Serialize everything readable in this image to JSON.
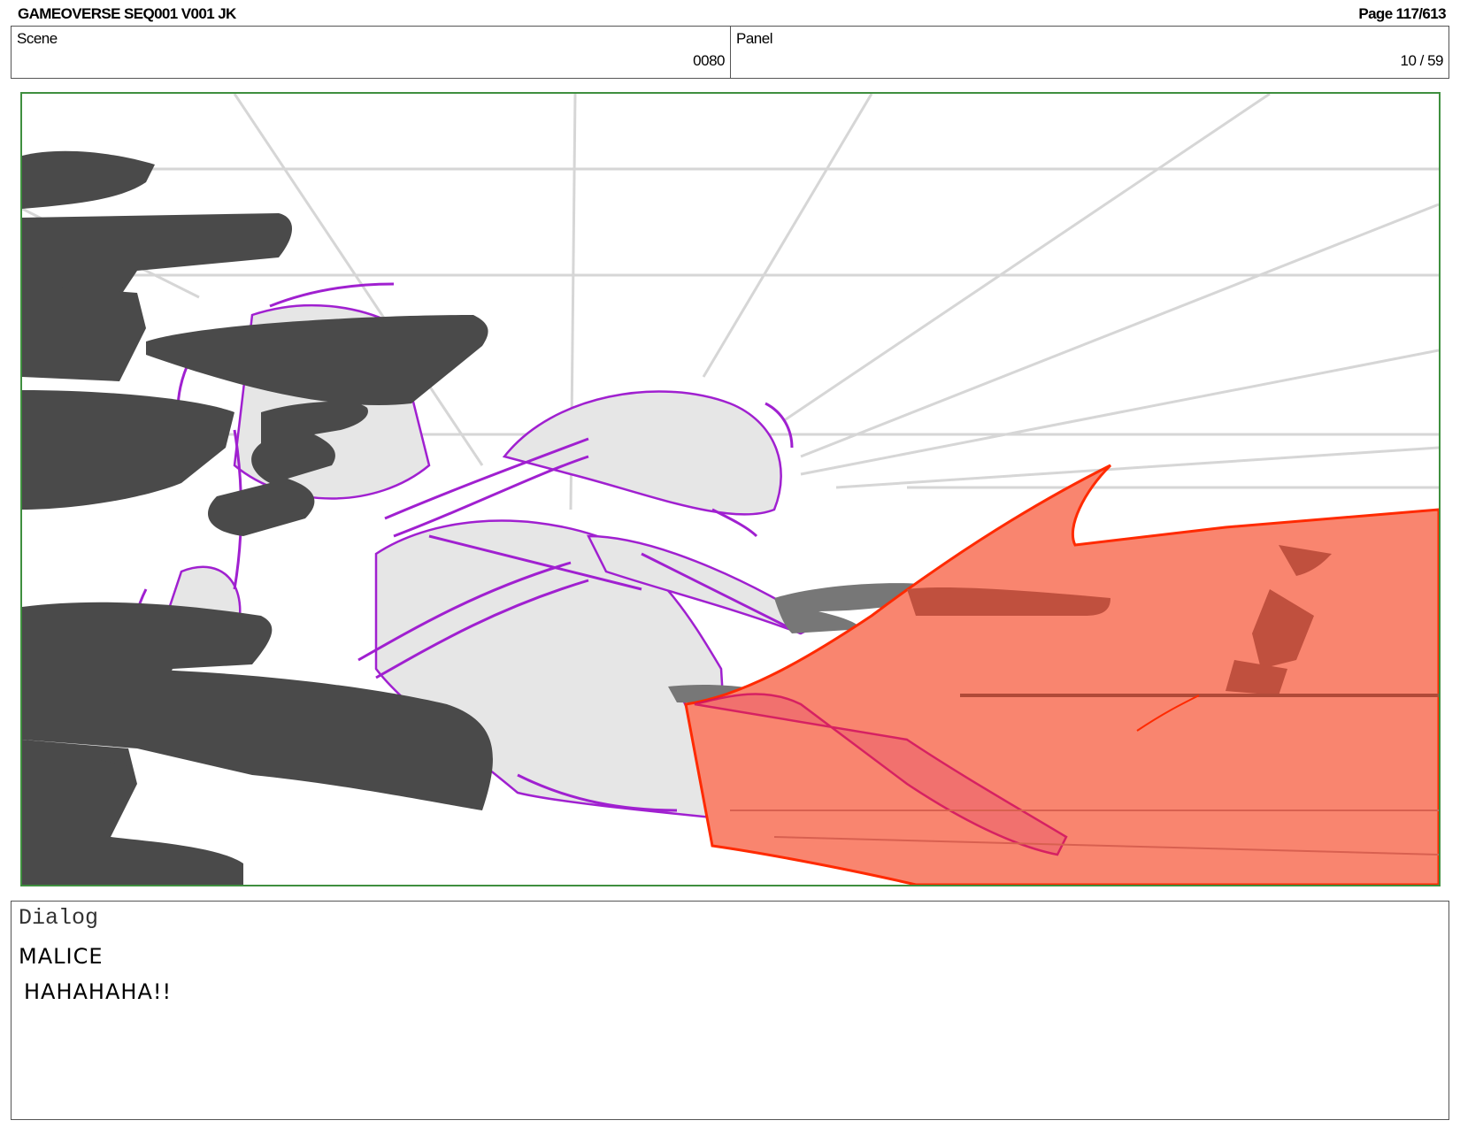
{
  "header": {
    "title": "GAMEOVERSE SEQ001 V001 JK",
    "page": "Page 117/613"
  },
  "info": {
    "scene_label": "Scene",
    "scene_value": "0080",
    "panel_label": "Panel",
    "panel_value": "10 / 59"
  },
  "panel_image": {
    "frame_color": "#3f8f3f",
    "colors": {
      "dark_shapes": "#4a4a4a",
      "sketch_purple": "#a020d0",
      "fill_gray": "#e6e6e6",
      "red_shape": "#f9856f",
      "red_stroke": "#ff2a00",
      "speed_lines": "#d6d6d6"
    }
  },
  "dialog": {
    "label": "Dialog",
    "speaker": "MALICE",
    "line": "HAHAHAHA!!"
  }
}
